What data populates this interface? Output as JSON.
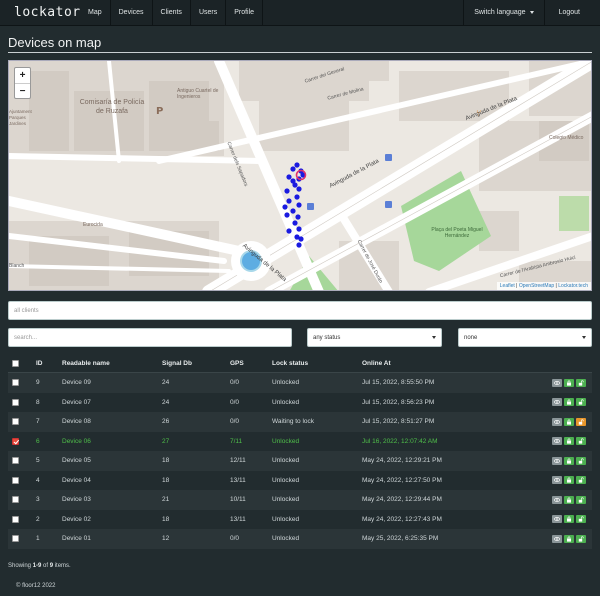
{
  "nav": {
    "brand": "lockator",
    "items": [
      "Map",
      "Devices",
      "Clients",
      "Users",
      "Profile"
    ],
    "switch_language": "Switch language",
    "logout": "Logout"
  },
  "page_title": "Devices on map",
  "map": {
    "zoom_in": "+",
    "zoom_out": "−",
    "labels": {
      "comisaria": "Comisaría de Policía de Ruzafa",
      "antiguo": "Antiguo Cuartel de Ingenieros",
      "general": "Carrer del General",
      "molina": "Carrer de Molina",
      "sapadors": "Carrer dels Sapadors",
      "avinguda1": "Avinguda de la Plata",
      "avinguda2": "Avinguda de la Plata",
      "avinguda3": "Avinguda de la Plata",
      "colegio": "Colegio Médico",
      "eurocida": "Eurocida",
      "blanch": "Blanch",
      "placa": "Plaça del Poeta Miguel Hernández",
      "arabista": "Carrer de l'Arabista Ambrosio Huici",
      "jose_duran": "Carrer de José Durán",
      "ajuntament": "Ajuntament Parques Jardines"
    },
    "attribution": {
      "leaflet": "Leaflet",
      "osm": "OpenStreetMap",
      "lockator": "Lockator.tech"
    }
  },
  "filters": {
    "clients_placeholder": "all clients",
    "search_placeholder": "search...",
    "status_value": "any status",
    "none_value": "none"
  },
  "table": {
    "headers": {
      "id": "ID",
      "name": "Readable name",
      "signal": "Signal Db",
      "gps": "GPS",
      "lock": "Lock status",
      "online": "Online At"
    },
    "rows": [
      {
        "id": "9",
        "name": "Device 09",
        "signal": "24",
        "gps": "0/0",
        "lock": "Unlocked",
        "online": "Jul 15, 2022, 8:55:50 PM"
      },
      {
        "id": "8",
        "name": "Device 07",
        "signal": "24",
        "gps": "0/0",
        "lock": "Unlocked",
        "online": "Jul 15, 2022, 8:56:23 PM"
      },
      {
        "id": "7",
        "name": "Device 08",
        "signal": "26",
        "gps": "0/0",
        "lock": "Waiting to lock",
        "online": "Jul 15, 2022, 8:51:27 PM"
      },
      {
        "id": "6",
        "name": "Device 06",
        "signal": "27",
        "gps": "7/11",
        "lock": "Unlocked",
        "online": "Jul 16, 2022, 12:07:42 AM"
      },
      {
        "id": "5",
        "name": "Device 05",
        "signal": "18",
        "gps": "12/11",
        "lock": "Unlocked",
        "online": "May 24, 2022, 12:29:21 PM"
      },
      {
        "id": "4",
        "name": "Device 04",
        "signal": "18",
        "gps": "13/11",
        "lock": "Unlocked",
        "online": "May 24, 2022, 12:27:50 PM"
      },
      {
        "id": "3",
        "name": "Device 03",
        "signal": "21",
        "gps": "10/11",
        "lock": "Unlocked",
        "online": "May 24, 2022, 12:29:44 PM"
      },
      {
        "id": "2",
        "name": "Device 02",
        "signal": "18",
        "gps": "13/11",
        "lock": "Unlocked",
        "online": "May 24, 2022, 12:27:43 PM"
      },
      {
        "id": "1",
        "name": "Device 01",
        "signal": "12",
        "gps": "0/0",
        "lock": "Unlocked",
        "online": "May 25, 2022, 6:25:35 PM"
      }
    ]
  },
  "summary": {
    "prefix": "Showing ",
    "range": "1-9",
    "middle": " of ",
    "total": "9",
    "suffix": " items."
  },
  "footer": "© floor12 2022",
  "colors": {
    "selected_text": "#4fbf4a",
    "btn_view": "#8a9598",
    "btn_lock": "#4caf50",
    "btn_waiting": "#e8962b",
    "marker": "#1a1ae0"
  }
}
